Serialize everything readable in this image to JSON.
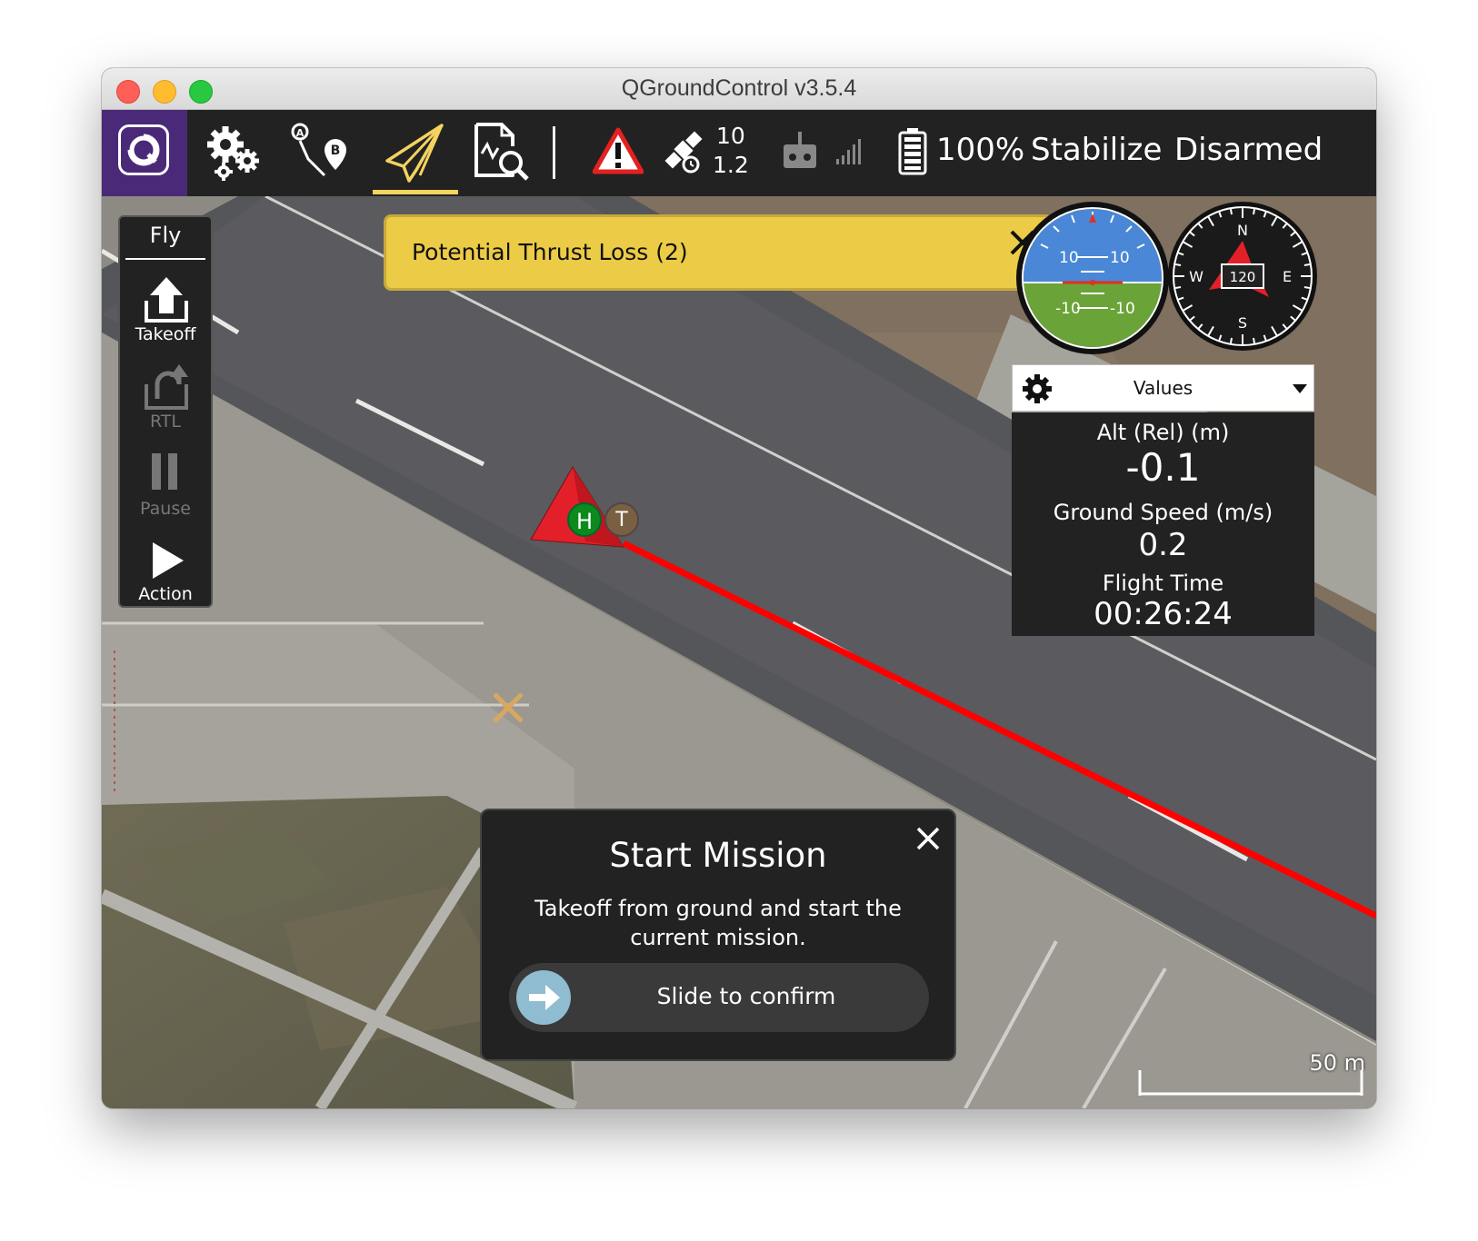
{
  "window": {
    "title": "QGroundControl v3.5.4"
  },
  "toolbar": {
    "icons": [
      "qgc-logo-icon",
      "settings-gears-icon",
      "plan-route-icon",
      "fly-paper-plane-icon",
      "analyze-document-icon",
      "warning-icon",
      "gps-satellite-icon",
      "rc-remote-icon",
      "signal-bars-icon",
      "battery-icon"
    ],
    "gps_count": "10",
    "gps_hdop": "1.2",
    "battery": "100%",
    "flight_mode": "Stabilize",
    "arm_state": "Disarmed",
    "active_tab": "fly",
    "accent_color": "#f4d35e",
    "logo_bg_color": "#4a2a78"
  },
  "fly_panel": {
    "title": "Fly",
    "buttons": [
      {
        "label": "Takeoff",
        "icon": "takeoff-arrow-icon",
        "enabled": true
      },
      {
        "label": "RTL",
        "icon": "rtl-return-icon",
        "enabled": false
      },
      {
        "label": "Pause",
        "icon": "pause-icon",
        "enabled": false
      },
      {
        "label": "Action",
        "icon": "play-icon",
        "enabled": true
      }
    ]
  },
  "alert": {
    "text": "Potential Thrust Loss (2)",
    "color": "#eccb46"
  },
  "attitude_indicator": {
    "ticks": [
      "10",
      "10",
      "-10",
      "-10"
    ]
  },
  "compass": {
    "heading": "120",
    "cardinals": [
      "N",
      "E",
      "S",
      "W"
    ]
  },
  "values_panel": {
    "title": "Values",
    "items": [
      {
        "label": "Alt (Rel) (m)",
        "value": "-0.1"
      },
      {
        "label": "Ground Speed (m/s)",
        "value": "0.2"
      },
      {
        "label": "Flight Time",
        "value": "00:26:24"
      }
    ]
  },
  "map": {
    "home_marker": "H",
    "takeoff_marker": "T",
    "scale_label": "50 m",
    "path_color": "#ff0000"
  },
  "dialog": {
    "title": "Start Mission",
    "message": "Takeoff from ground and start the current mission.",
    "slider_label": "Slide to confirm"
  }
}
